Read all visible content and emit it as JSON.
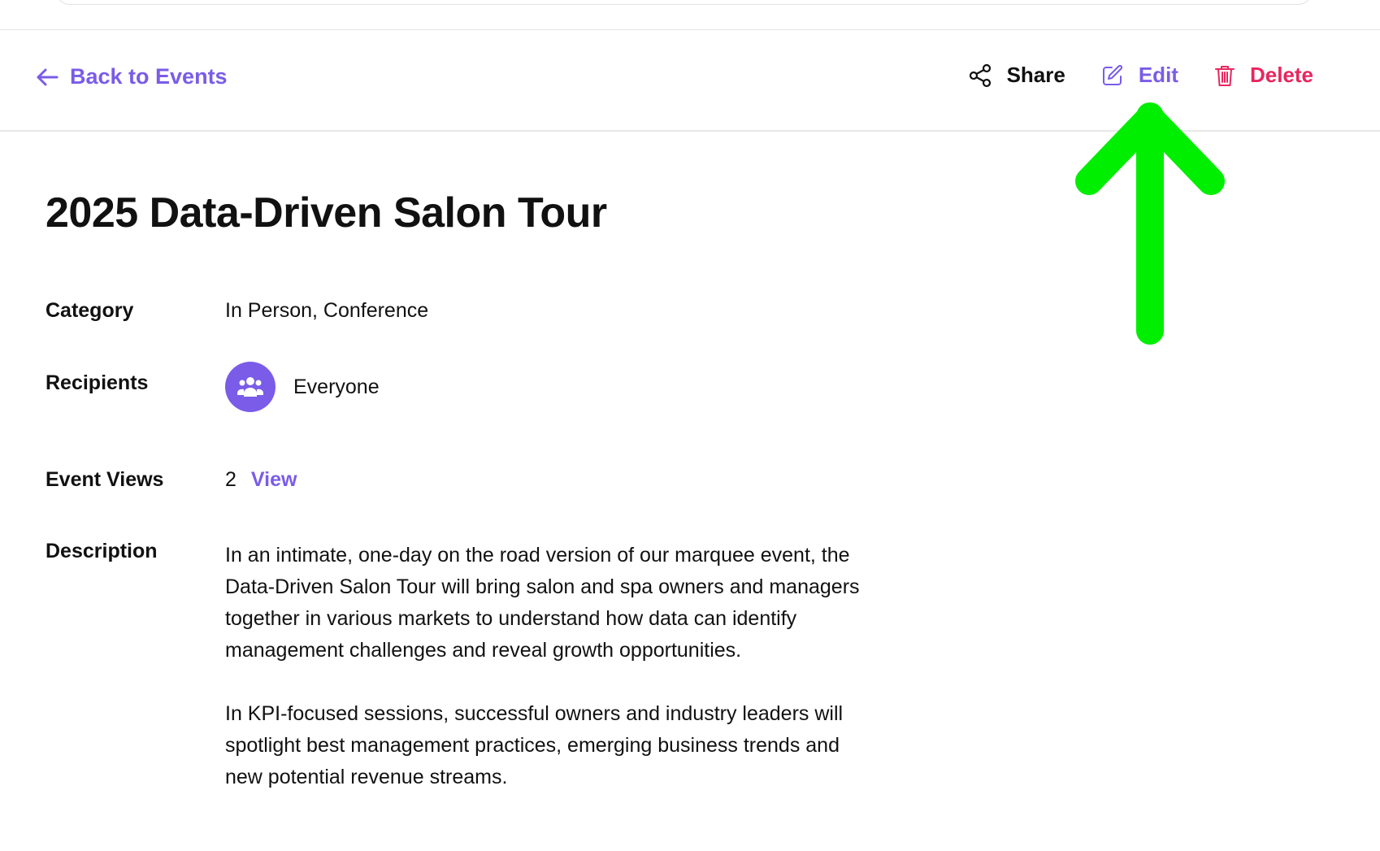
{
  "toolbar": {
    "back_label": "Back to Events",
    "share_label": "Share",
    "edit_label": "Edit",
    "delete_label": "Delete"
  },
  "event": {
    "title": "2025 Data-Driven Salon Tour",
    "category_label": "Category",
    "category_value": "In Person, Conference",
    "recipients_label": "Recipients",
    "recipients_value": "Everyone",
    "views_label": "Event Views",
    "views_count": "2",
    "views_link": "View",
    "description_label": "Description",
    "description_paragraphs": [
      "In an intimate, one-day on the road version of our marquee event, the Data-Driven Salon Tour will bring salon and spa owners and managers together in various markets to understand how data can identify management challenges and reveal growth opportunities.",
      "In KPI-focused sessions, successful owners and industry leaders will spotlight best management practices, emerging business trends and new potential revenue streams."
    ]
  },
  "icons": {
    "back": "arrow-left-icon",
    "share": "share-icon",
    "edit": "edit-pencil-icon",
    "delete": "trash-icon",
    "recipients": "group-users-icon",
    "annotation": "arrow-up-icon"
  },
  "colors": {
    "accent": "#7a5ce8",
    "danger": "#e8265e",
    "annotation": "#00ee00"
  }
}
